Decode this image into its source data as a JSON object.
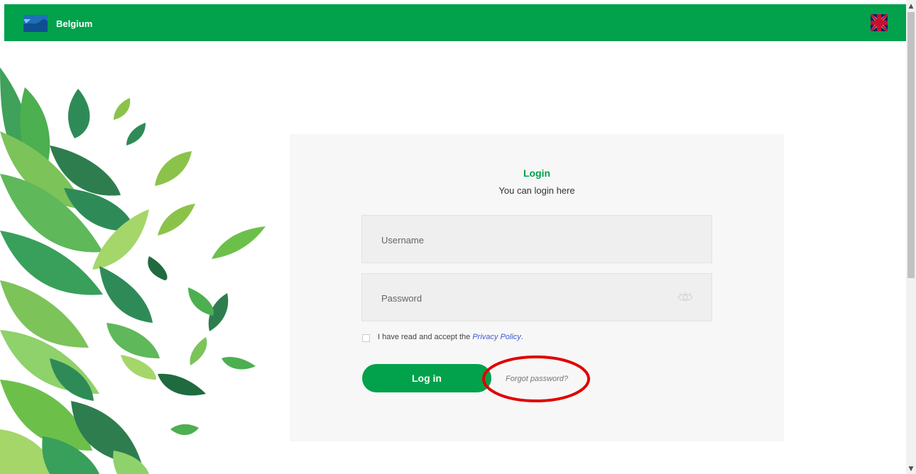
{
  "header": {
    "brand": "Belgium",
    "language_flag_icon": "uk-flag-icon",
    "background_color": "#02a14c"
  },
  "login_card": {
    "title": "Login",
    "subtitle": "You can login here",
    "username": {
      "placeholder": "Username",
      "value": ""
    },
    "password": {
      "placeholder": "Password",
      "value": "",
      "toggle_icon": "eye-icon"
    },
    "consent": {
      "checked": false,
      "text_before": "I have read and accept the ",
      "link": "Privacy Policy",
      "text_after": "."
    },
    "login_button": "Log in",
    "forgot_link": "Forgot password?"
  },
  "colors": {
    "accent": "#02a14c",
    "link": "#3b5bd6",
    "annotation": "#e00000"
  }
}
